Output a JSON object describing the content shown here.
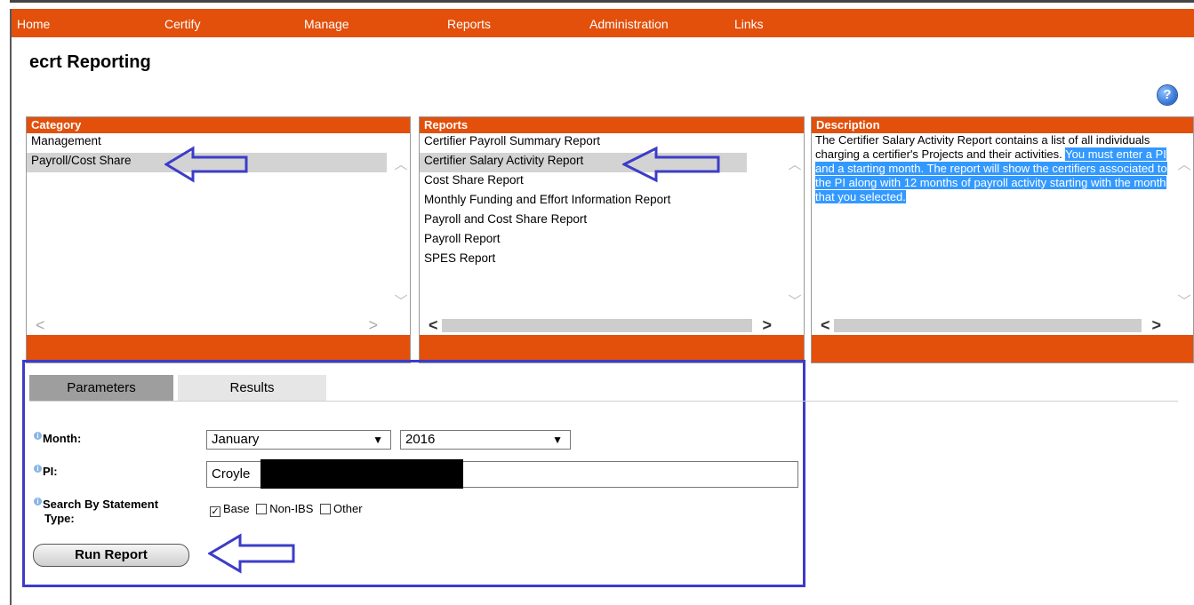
{
  "nav": {
    "items": [
      "Home",
      "Certify",
      "Manage",
      "Reports",
      "Administration",
      "Links"
    ]
  },
  "page_title": "ecrt Reporting",
  "help_icon": "?",
  "category_panel": {
    "header": "Category",
    "items": [
      "Management",
      "Payroll/Cost Share"
    ],
    "selected": "Payroll/Cost Share"
  },
  "reports_panel": {
    "header": "Reports",
    "items": [
      "Certifier Payroll Summary Report",
      "Certifier Salary Activity Report",
      "Cost Share Report",
      "Monthly Funding and Effort Information Report",
      "Payroll and Cost Share Report",
      "Payroll Report",
      "SPES Report"
    ],
    "selected": "Certifier Salary Activity Report"
  },
  "description_panel": {
    "header": "Description",
    "text_plain": "The Certifier Salary Activity Report contains a list of all individuals charging a certifier's Projects and their activities.",
    "text_highlighted": "You must enter a PI and a starting month. The report will show the certifiers associated to the PI along with 12 months of payroll activity starting with the month that you selected."
  },
  "tabs": {
    "parameters": "Parameters",
    "results": "Results"
  },
  "form": {
    "month_label": "Month:",
    "month_value": "January",
    "year_value": "2016",
    "pi_label": "PI:",
    "pi_value": "Croyle",
    "statement_label_line1": "Search By Statement",
    "statement_label_line2": "Type:",
    "checkbox_base": "Base",
    "checkbox_base_checked": true,
    "checkbox_nonibs": "Non-IBS",
    "checkbox_nonibs_checked": false,
    "checkbox_other": "Other",
    "checkbox_other_checked": false,
    "run_button": "Run Report"
  },
  "colors": {
    "brand_orange": "#e2500c",
    "annotation_blue": "#3c3cc8",
    "selection_blue": "#3399ff"
  }
}
